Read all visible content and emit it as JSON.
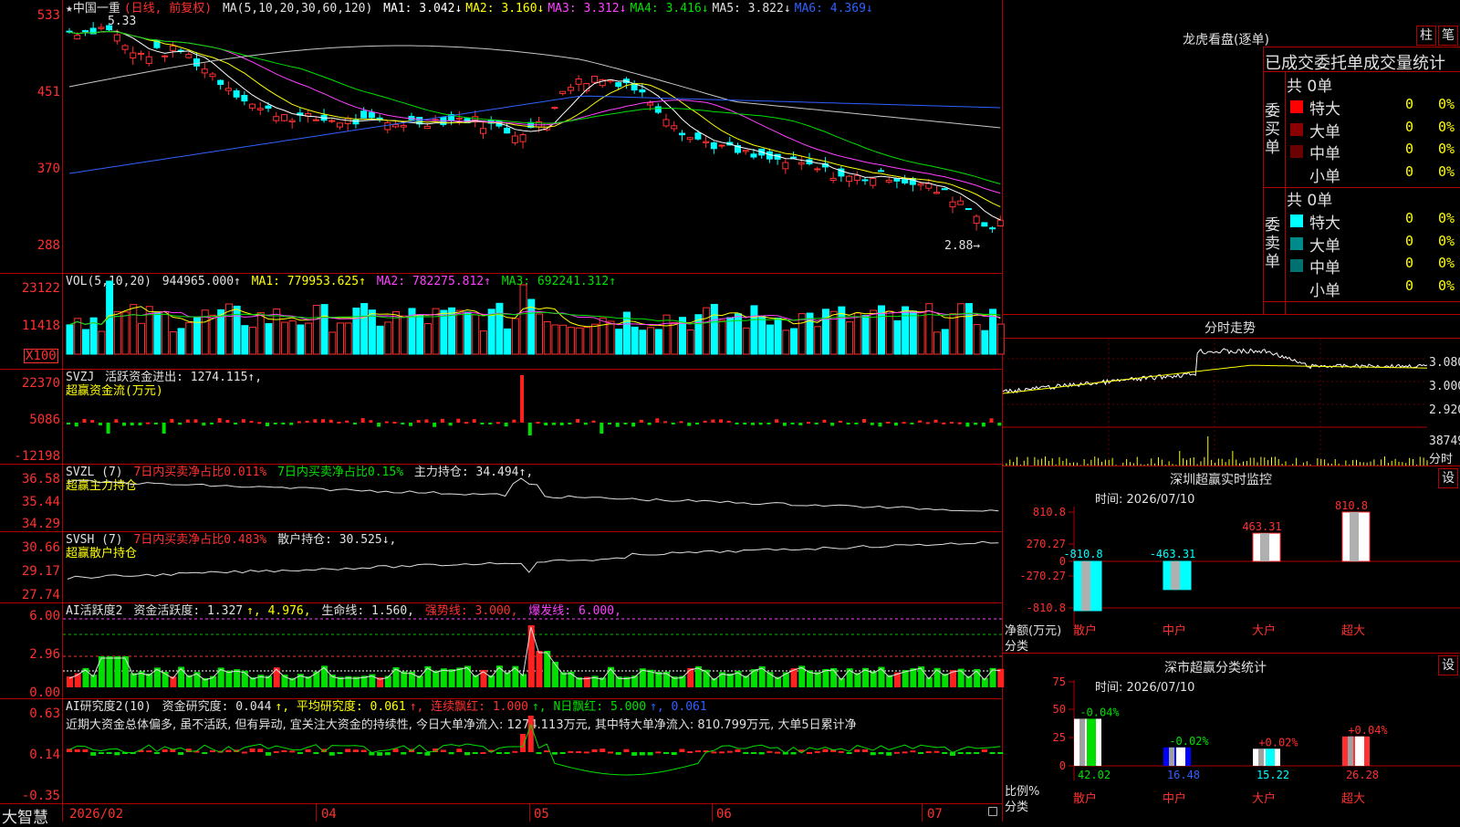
{
  "main_chart": {
    "stock_name": "★中国一重",
    "period": "(日线, 前复权)",
    "ma_header": "MA(5,10,20,30,60,120)",
    "ma": [
      {
        "label": "MA1: 3.042↓",
        "color": "#ffffff"
      },
      {
        "label": "MA2: 3.160↓",
        "color": "#ffff00"
      },
      {
        "label": "MA3: 3.312↓",
        "color": "#ff40ff"
      },
      {
        "label": "MA4: 3.416↓",
        "color": "#00e000"
      },
      {
        "label": "MA5: 3.822↓",
        "color": "#e0e0e0"
      },
      {
        "label": "MA6: 4.369↓",
        "color": "#3060ff"
      }
    ],
    "y_labels": [
      "533",
      "451",
      "370",
      "288"
    ],
    "high_label": "5.33",
    "low_label": "2.88→"
  },
  "vol": {
    "header": "VOL(5,10,20)",
    "value": "944965.000↑",
    "ma1": "MA1: 779953.625↑",
    "ma2": "MA2: 782275.812↑",
    "ma3": "MA3: 692241.312↑",
    "y_labels": [
      "23122",
      "11418"
    ],
    "unit": "X100"
  },
  "svzj": {
    "header": "SVZJ",
    "value": "活跃资金进出: 1274.115↑,",
    "subtitle": "超赢资金流(万元)",
    "y_labels": [
      "22370",
      "5086",
      "-12198"
    ]
  },
  "svzl": {
    "header": "SVZL (7)",
    "a": "7日内买卖净占比0.011%",
    "b": "7日内买卖净占比0.15%",
    "c": "主力持仓: 34.494↑,",
    "subtitle": "超赢主力持仓",
    "y_labels": [
      "36.58",
      "35.44",
      "34.29"
    ]
  },
  "svsh": {
    "header": "SVSH (7)",
    "a": "7日内买卖净占比0.483%",
    "c": "散户持仓: 30.525↓,",
    "subtitle": "超赢散户持仓",
    "y_labels": [
      "30.66",
      "29.17",
      "27.74"
    ]
  },
  "ai_active": {
    "header": "AI活跃度2",
    "a": "资金活跃度: 1.327",
    "b": "↑, 4.976,",
    "c": "生命线: 1.560,",
    "d": "强势线: 3.000,",
    "e": "爆发线: 6.000,",
    "y_labels": [
      "6.00",
      "2.96",
      "0.00"
    ]
  },
  "ai_research": {
    "header": "AI研究度2(10)",
    "a": "资金研究度: 0.044",
    "b": "↑, 平均研究度: 0.061",
    "c": "↑, 连续飘红: 1.000",
    "d": "↑, N日飘红: 5.000",
    "e": "↑, 0.061",
    "comment": "近期大资金总体偏多, 虽不活跃, 但有异动, 宜关注大资金的持续性, 今日大单净流入: 1274.113万元, 其中特大单净流入: 810.799万元, 大单5日累计净",
    "y_labels": [
      "0.63",
      "0.14",
      "-0.35"
    ]
  },
  "x_axis": {
    "brand": "大智慧",
    "ticks": [
      "2026/02",
      "04",
      "05",
      "06",
      "07"
    ]
  },
  "right_panel": {
    "lhb_title": "龙虎看盘(逐单)",
    "btn_zhu": "柱",
    "btn_bi": "笔",
    "stats_title": "已成交委托单成交量统计",
    "buy_total": "共 0单",
    "buy_label": "委买单",
    "sell_total": "共 0单",
    "sell_label": "委卖单",
    "buy_rows": [
      {
        "name": "特大",
        "count": "0",
        "pct": "0%",
        "color": "#ff0000"
      },
      {
        "name": "大单",
        "count": "0",
        "pct": "0%",
        "color": "#8b0000"
      },
      {
        "name": "中单",
        "count": "0",
        "pct": "0%",
        "color": "#6a0000"
      },
      {
        "name": "小单",
        "count": "0",
        "pct": "0%",
        "color": ""
      }
    ],
    "sell_rows": [
      {
        "name": "特大",
        "count": "0",
        "pct": "0%",
        "color": "#00ffff"
      },
      {
        "name": "大单",
        "count": "0",
        "pct": "0%",
        "color": "#008b8b"
      },
      {
        "name": "中单",
        "count": "0",
        "pct": "0%",
        "color": "#007070"
      },
      {
        "name": "小单",
        "count": "0",
        "pct": "0%",
        "color": ""
      }
    ],
    "intraday_title": "分时走势",
    "intraday_y": [
      "3.080",
      "3.000",
      "2.920"
    ],
    "intraday_vol": "38749",
    "intraday_unit": "分时",
    "monitor_title": "深圳超赢实时监控",
    "set_label": "设",
    "monitor_time": "时间: 2026/07/10",
    "monitor_y": [
      "810.8",
      "270.27",
      "0",
      "-270.27",
      "-810.8"
    ],
    "monitor_ylabel": "净额(万元)",
    "monitor_xlabel": "分类",
    "monitor_cats": [
      "散户",
      "中户",
      "大户",
      "超大"
    ],
    "monitor_values": [
      -810.8,
      -463.31,
      463.31,
      810.8
    ],
    "monitor_value_labels": [
      "-810.8",
      "-463.31",
      "463.31",
      "810.8"
    ],
    "class_title": "深市超赢分类统计",
    "class_time": "时间: 2026/07/10",
    "class_y": [
      "75",
      "50",
      "25",
      "0"
    ],
    "class_ylabel": "比例%",
    "class_xlabel": "分类",
    "class_cats": [
      "散户",
      "中户",
      "大户",
      "超大"
    ],
    "class_values": [
      42.02,
      16.48,
      15.22,
      26.28
    ],
    "class_value_labels": [
      "42.02",
      "16.48",
      "15.22",
      "26.28"
    ],
    "class_changes": [
      "-0.04%",
      "-0.02%",
      "+0.02%",
      "+0.04%"
    ]
  },
  "colors": {
    "up": "#ff3030",
    "down": "#00ffff",
    "border": "#b00000"
  }
}
